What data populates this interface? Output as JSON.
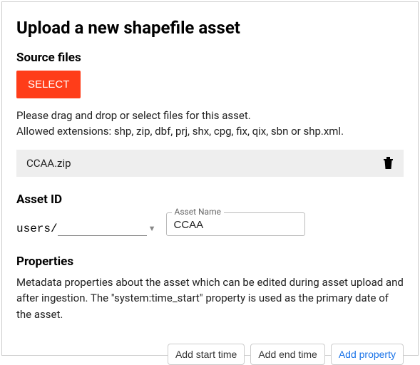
{
  "title": "Upload a new shapefile asset",
  "source": {
    "heading": "Source files",
    "select_label": "SELECT",
    "hint_line1": "Please drag and drop or select files for this asset.",
    "hint_line2": "Allowed extensions: shp, zip, dbf, prj, shx, cpg, fix, qix, sbn or shp.xml.",
    "file_name": "CCAA.zip"
  },
  "asset_id": {
    "heading": "Asset ID",
    "prefix": "users/",
    "path_value": "",
    "name_label": "Asset Name",
    "name_value": "CCAA"
  },
  "properties": {
    "heading": "Properties",
    "description": "Metadata properties about the asset which can be edited during asset upload and after ingestion. The \"system:time_start\" property is used as the primary date of the asset.",
    "add_start_label": "Add start time",
    "add_end_label": "Add end time",
    "add_prop_label": "Add property"
  }
}
